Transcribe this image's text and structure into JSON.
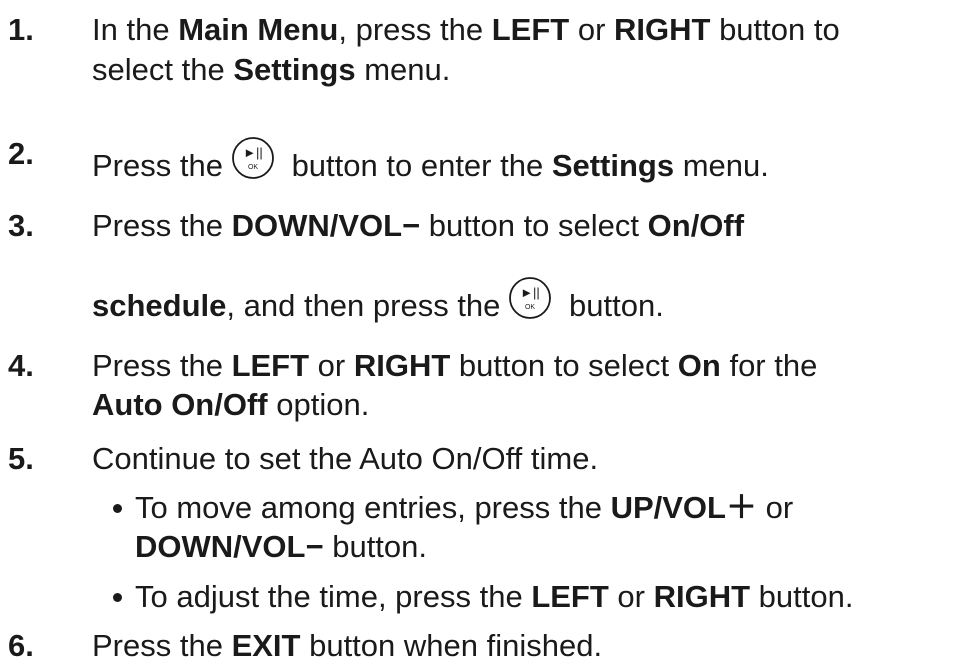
{
  "steps": [
    {
      "number": "1.",
      "line1": {
        "a": "In the ",
        "b1": "Main Menu",
        "c": ", press the ",
        "b2": "LEFT",
        "d": " or ",
        "b3": "RIGHT",
        "e": " button to"
      },
      "line2": {
        "a": "select the ",
        "b1": "Settings",
        "c": " menu."
      }
    },
    {
      "number": "2.",
      "line1": {
        "a": "Press the",
        "c": " button to enter the ",
        "b1": "Settings",
        "d": " menu."
      }
    },
    {
      "number": "3.",
      "line1": {
        "a": "Press the ",
        "b1": "DOWN/VOL−",
        "c": "  button to select ",
        "b2": "On/Off"
      },
      "line2": {
        "b1": "schedule",
        "c": ", and then press the",
        "d": " button."
      }
    },
    {
      "number": "4.",
      "line1": {
        "a": "Press the ",
        "b1": "LEFT",
        "c": " or ",
        "b2": "RIGHT",
        "d": " button to select ",
        "b3": "On",
        "e": " for the"
      },
      "line2": {
        "b1": "Auto On/Off",
        "c": " option."
      }
    },
    {
      "number": "5.",
      "line1": {
        "a": "Continue to set the Auto On/Off time."
      },
      "bullets": [
        {
          "line1": {
            "a": "To move among entries, press the ",
            "b1": "UP/VOL＋",
            "c": "  or"
          },
          "line2": {
            "b1": "DOWN/VOL−",
            "c": "  button."
          }
        },
        {
          "line1": {
            "a": "To adjust the time, press the ",
            "b1": "LEFT",
            "c": " or ",
            "b2": "RIGHT",
            "d": " button."
          }
        }
      ]
    },
    {
      "number": "6.",
      "line1": {
        "a": "Press the ",
        "b1": "EXIT",
        "c": " button when finished."
      }
    }
  ],
  "ok_button": {
    "icon": "play-pause-ok-icon",
    "symbol": "►||",
    "caption": "OK"
  }
}
